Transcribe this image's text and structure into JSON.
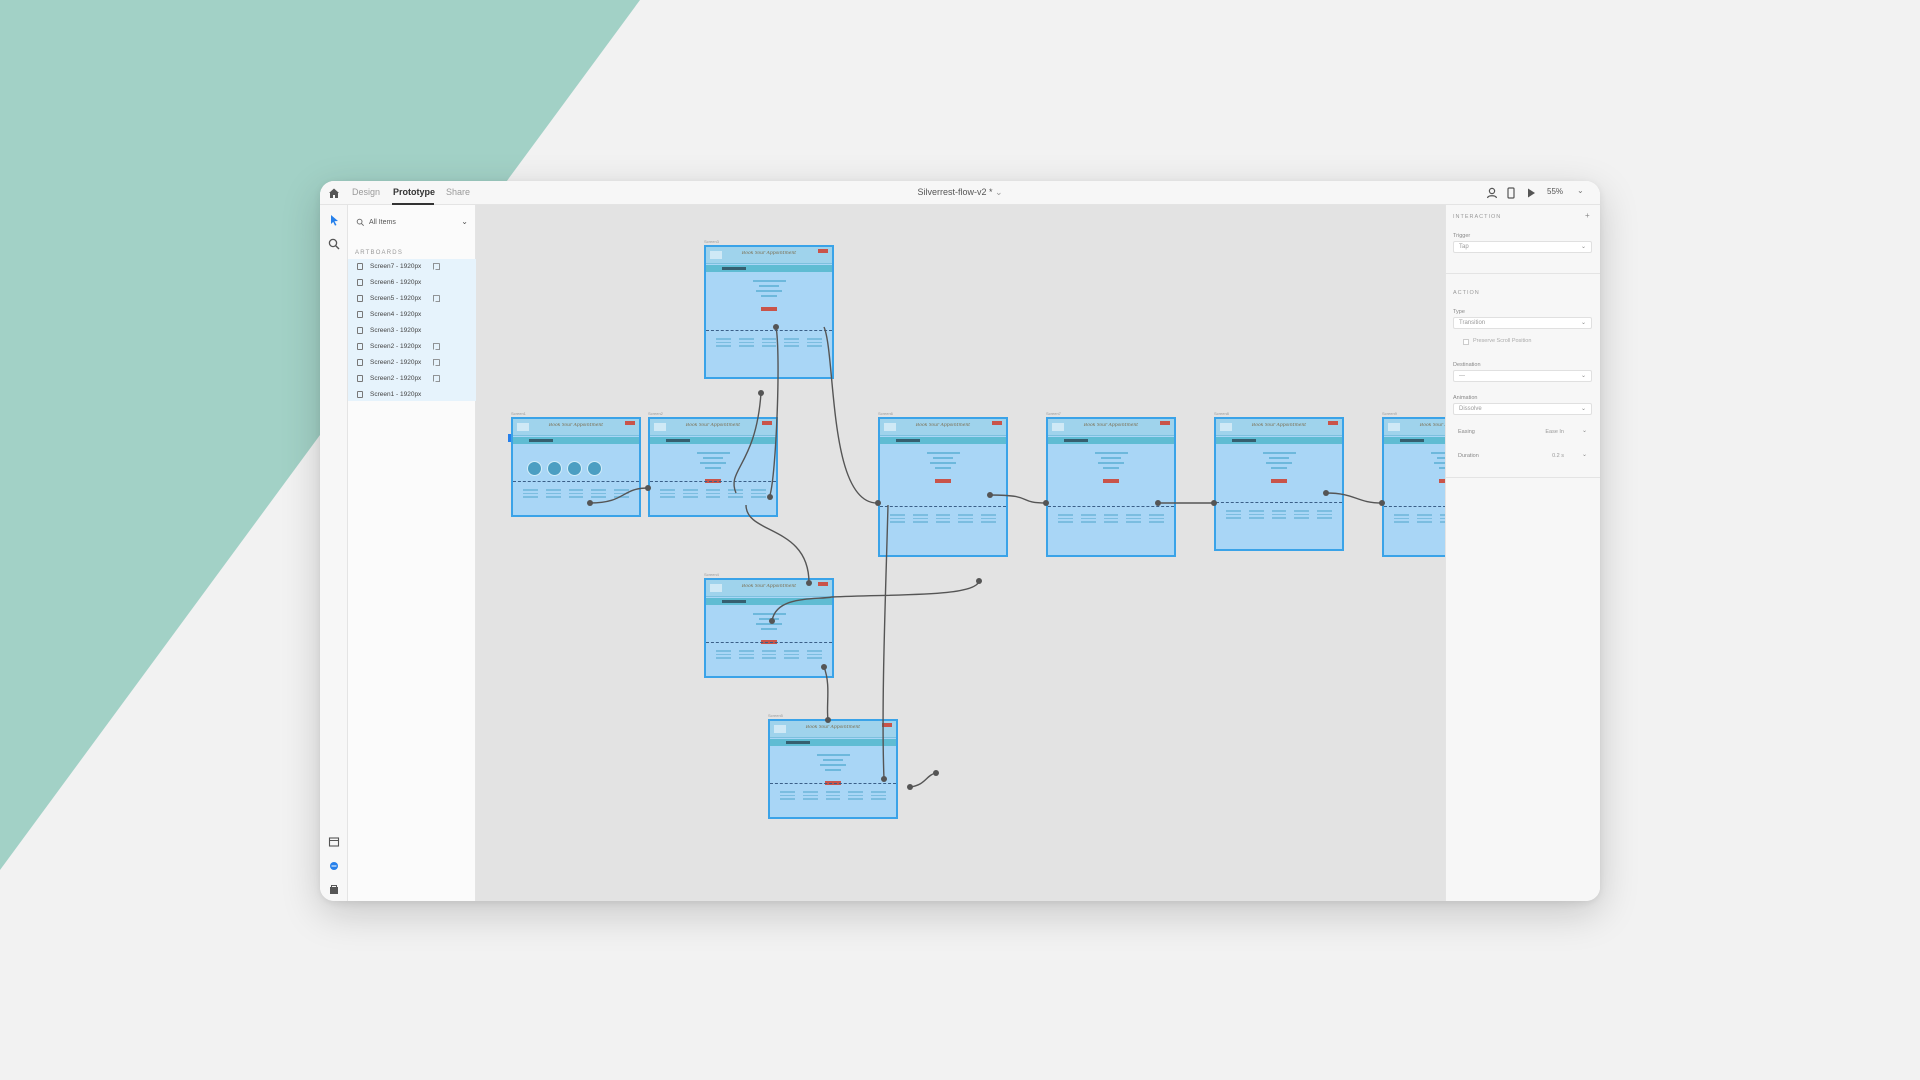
{
  "colors": {
    "background": "#f2f2f2",
    "accent_shape": "#a2d1c6",
    "artboard_fill": "#a9d6f6",
    "artboard_border": "#3aa3e8",
    "wire": "#555555",
    "selection_blue": "#2680eb",
    "cta_red": "#c9544a"
  },
  "top_bar": {
    "home_icon": "home-icon",
    "tabs": [
      {
        "label": "Design",
        "active": false
      },
      {
        "label": "Prototype",
        "active": true
      },
      {
        "label": "Share",
        "active": false
      }
    ],
    "document_title": "Silverrest-flow-v2 *",
    "icons": [
      "user-icon",
      "device-preview-icon",
      "play-icon"
    ],
    "zoom": "55%"
  },
  "tool_rail": {
    "tools": [
      "select-arrow-icon",
      "zoom-icon"
    ],
    "bottom_tools": [
      "document-assets-icon",
      "plugins-icon",
      "libraries-icon"
    ]
  },
  "layers": {
    "search_label": "All Items",
    "heading": "ARTBOARDS",
    "artboards": [
      {
        "label": "Screen7 - 1920px",
        "has_flow": true
      },
      {
        "label": "Screen6 - 1920px",
        "has_flow": false
      },
      {
        "label": "Screen5 - 1920px",
        "has_flow": true
      },
      {
        "label": "Screen4 - 1920px",
        "has_flow": false
      },
      {
        "label": "Screen3 - 1920px",
        "has_flow": false
      },
      {
        "label": "Screen2 - 1920px",
        "has_flow": true
      },
      {
        "label": "Screen2 - 1920px",
        "has_flow": true
      },
      {
        "label": "Screen2 - 1920px",
        "has_flow": true
      },
      {
        "label": "Screen1 - 1920px",
        "has_flow": false
      }
    ]
  },
  "canvas": {
    "artboard_title": "Book Your Appointment",
    "artboards": [
      {
        "label": "Screen1",
        "variant": "home"
      },
      {
        "label": "Screen2",
        "variant": "form"
      },
      {
        "label": "Screen3",
        "variant": "form"
      },
      {
        "label": "Screen4",
        "variant": "form"
      },
      {
        "label": "Screen5",
        "variant": "form"
      },
      {
        "label": "Screen6",
        "variant": "form"
      },
      {
        "label": "Screen7",
        "variant": "form"
      },
      {
        "label": "Screen8",
        "variant": "form"
      },
      {
        "label": "Screen9",
        "variant": "form"
      }
    ]
  },
  "properties": {
    "interaction_heading": "INTERACTION",
    "trigger_label": "Trigger",
    "trigger_value": "Tap",
    "action_heading": "ACTION",
    "type_label": "Type",
    "type_value": "Transition",
    "preserve_label": "Preserve Scroll Position",
    "destination_label": "Destination",
    "destination_value": "—",
    "animation_label": "Animation",
    "animation_value": "Dissolve",
    "easing_label": "Easing",
    "easing_value": "Ease In",
    "duration_label": "Duration",
    "duration_value": "0.2 s"
  }
}
